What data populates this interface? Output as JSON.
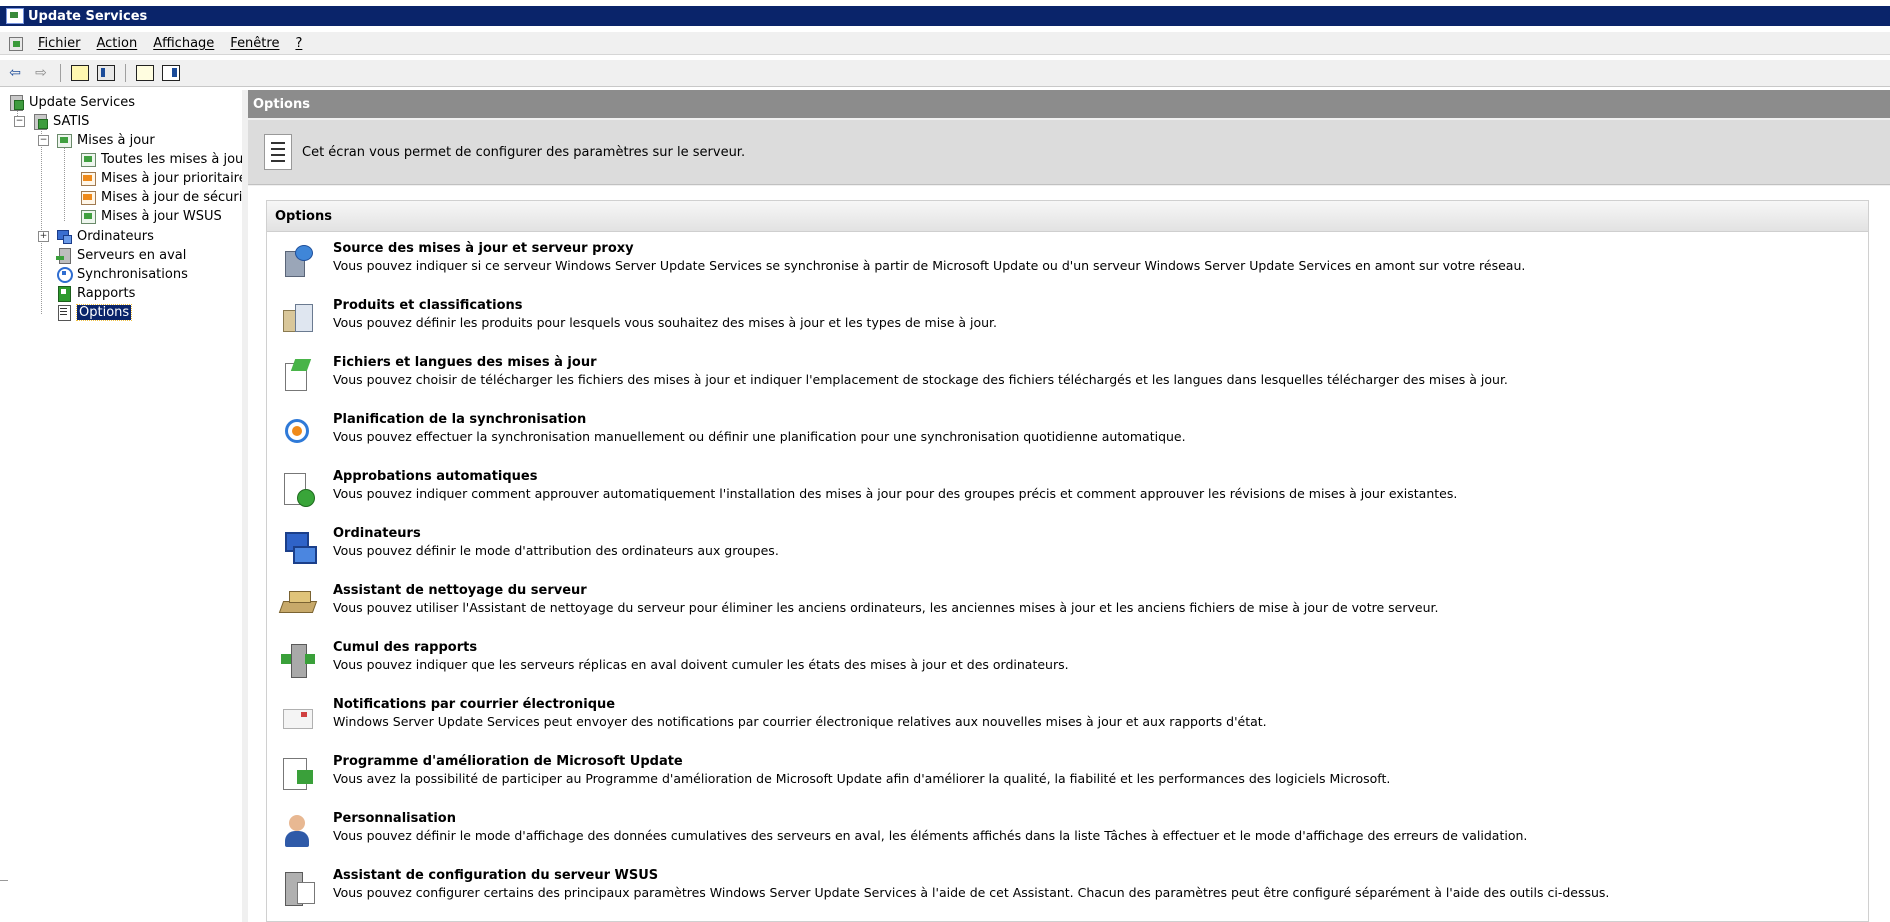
{
  "window": {
    "title": "Update Services"
  },
  "menu": {
    "items": [
      {
        "label": "Fichier"
      },
      {
        "label": "Action"
      },
      {
        "label": "Affichage"
      },
      {
        "label": "Fenêtre"
      },
      {
        "label": "?"
      }
    ]
  },
  "toolbar": {
    "buttons": [
      {
        "icon": "back-arrow-icon"
      },
      {
        "icon": "forward-arrow-icon"
      },
      {
        "icon": "up-folder-icon"
      },
      {
        "icon": "show-hide-tree-icon"
      },
      {
        "icon": "help-icon"
      },
      {
        "icon": "show-hide-action-pane-icon"
      }
    ]
  },
  "tree": {
    "root": "Update Services",
    "server": "SATIS",
    "updates": "Mises à jour",
    "update_children": [
      "Toutes les mises à jour",
      "Mises à jour prioritaires",
      "Mises à jour de sécurité",
      "Mises à jour WSUS"
    ],
    "computers": "Ordinateurs",
    "downstream": "Serveurs en aval",
    "sync": "Synchronisations",
    "reports": "Rapports",
    "options": "Options"
  },
  "main": {
    "header": "Options",
    "description": "Cet écran vous permet de configurer des paramètres sur le serveur.",
    "options_heading": "Options",
    "options": [
      {
        "title": "Source des mises à jour et serveur proxy",
        "desc": "Vous pouvez indiquer si ce serveur Windows Server Update Services se synchronise à partir de Microsoft Update ou d'un serveur Windows Server Update Services en amont sur votre réseau.",
        "icon": "update-source-proxy-icon"
      },
      {
        "title": "Produits et classifications",
        "desc": "Vous pouvez définir les produits pour lesquels vous souhaitez des mises à jour et les types de mise à jour.",
        "icon": "products-classifications-icon"
      },
      {
        "title": "Fichiers et langues des mises à jour",
        "desc": "Vous pouvez choisir de télécharger les fichiers des mises à jour et indiquer l'emplacement de stockage des fichiers téléchargés et les langues dans lesquelles télécharger des mises à jour.",
        "icon": "update-files-languages-icon"
      },
      {
        "title": "Planification de la synchronisation",
        "desc": "Vous pouvez effectuer la synchronisation manuellement ou définir une planification pour une synchronisation quotidienne automatique.",
        "icon": "sync-schedule-icon"
      },
      {
        "title": "Approbations automatiques",
        "desc": "Vous pouvez indiquer comment approuver automatiquement l'installation des mises à jour pour des groupes précis et comment approuver les révisions de mises à jour existantes.",
        "icon": "automatic-approvals-icon"
      },
      {
        "title": "Ordinateurs",
        "desc": "Vous pouvez définir le mode d'attribution des ordinateurs aux groupes.",
        "icon": "computers-icon"
      },
      {
        "title": "Assistant de nettoyage du serveur",
        "desc": "Vous pouvez utiliser l'Assistant de nettoyage du serveur pour éliminer les anciens ordinateurs, les anciennes mises à jour et les anciens fichiers de mise à jour de votre serveur.",
        "icon": "server-cleanup-icon"
      },
      {
        "title": "Cumul des rapports",
        "desc": "Vous pouvez indiquer que les serveurs réplicas en aval doivent cumuler les états des mises à jour et des ordinateurs.",
        "icon": "reporting-rollup-icon"
      },
      {
        "title": "Notifications par courrier électronique",
        "desc": "Windows Server Update Services peut envoyer des notifications par courrier électronique relatives aux nouvelles mises à jour et aux rapports d'état.",
        "icon": "email-notification-icon"
      },
      {
        "title": "Programme d'amélioration de Microsoft Update",
        "desc": "Vous avez la possibilité de participer au Programme d'amélioration de Microsoft Update afin d'améliorer la qualité, la fiabilité et les performances des logiciels Microsoft.",
        "icon": "improvement-program-icon"
      },
      {
        "title": "Personnalisation",
        "desc": "Vous pouvez définir le mode d'affichage des données cumulatives des serveurs en aval, les éléments affichés dans la liste Tâches à effectuer et le mode d'affichage des erreurs de validation.",
        "icon": "personalization-icon"
      },
      {
        "title": "Assistant de configuration du serveur WSUS",
        "desc": "Vous pouvez configurer certains des principaux paramètres Windows Server Update Services à l'aide de cet Assistant. Chacun des paramètres peut être configuré séparément à l'aide des outils ci-dessus.",
        "icon": "wsus-config-wizard-icon"
      }
    ]
  },
  "colors": {
    "titlebar": "#0a246a",
    "section_bar": "#8c8c8c",
    "selection": "#0a246a"
  }
}
